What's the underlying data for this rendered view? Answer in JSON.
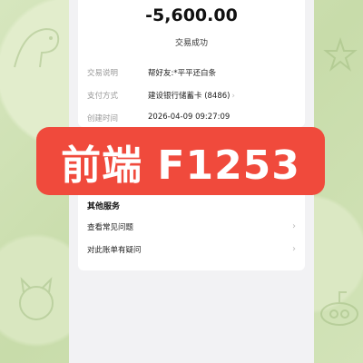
{
  "transaction": {
    "amount": "-5,600.00",
    "status": "交易成功"
  },
  "details": [
    {
      "label": "交易说明",
      "value": "帮好友:*平平还白条"
    },
    {
      "label": "支付方式",
      "value": "建设银行储蓄卡 (8486)"
    },
    {
      "label": "创建时间",
      "value": "2026-04-09 09:27:09"
    }
  ],
  "other_services": {
    "title": "其他服务",
    "items": [
      {
        "label": "查看常见问题"
      },
      {
        "label": "对此账单有疑问"
      }
    ]
  },
  "banner": {
    "text": "前端 F1253",
    "color": "#f04a3c"
  },
  "icons": {
    "chevron": "chevron-right-icon"
  }
}
